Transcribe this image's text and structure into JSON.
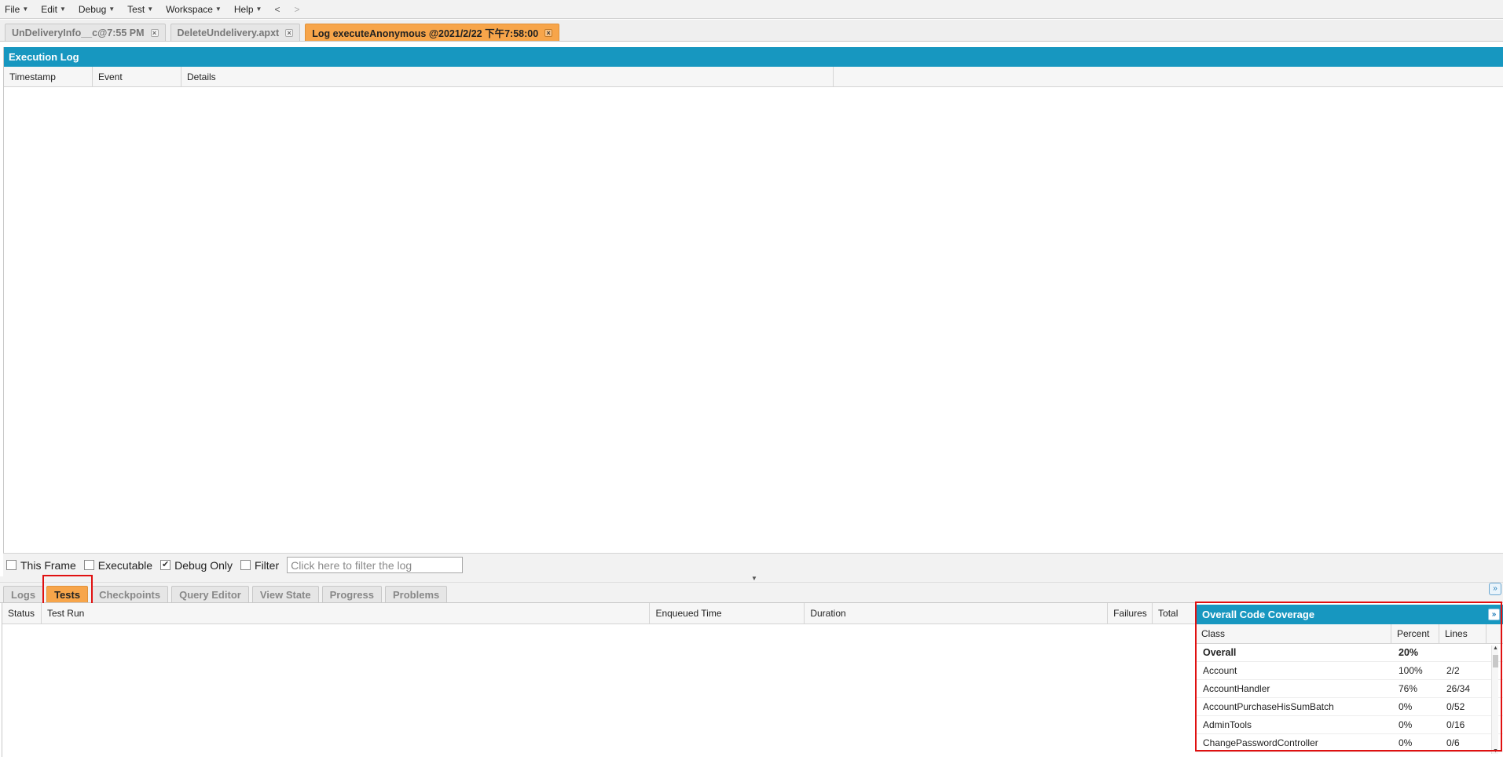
{
  "menu": {
    "items": [
      "File",
      "Edit",
      "Debug",
      "Test",
      "Workspace",
      "Help"
    ],
    "back_arrow": "<",
    "forward_arrow": ">"
  },
  "file_tabs": [
    {
      "label": "UnDeliveryInfo__c@7:55 PM",
      "active": false
    },
    {
      "label": "DeleteUndelivery.apxt",
      "active": false
    },
    {
      "label": "Log executeAnonymous @2021/2/22 下午7:58:00",
      "active": true
    }
  ],
  "execution_log": {
    "title": "Execution Log",
    "columns": [
      "Timestamp",
      "Event",
      "Details"
    ]
  },
  "filter_bar": {
    "this_frame": {
      "label": "This Frame",
      "checked": false
    },
    "executable": {
      "label": "Executable",
      "checked": false
    },
    "debug_only": {
      "label": "Debug Only",
      "checked": true
    },
    "filter": {
      "label": "Filter",
      "checked": false
    },
    "filter_placeholder": "Click here to filter the log"
  },
  "bottom_tabs": [
    {
      "label": "Logs",
      "active": false
    },
    {
      "label": "Tests",
      "active": true
    },
    {
      "label": "Checkpoints",
      "active": false
    },
    {
      "label": "Query Editor",
      "active": false
    },
    {
      "label": "View State",
      "active": false
    },
    {
      "label": "Progress",
      "active": false
    },
    {
      "label": "Problems",
      "active": false
    }
  ],
  "tests_table": {
    "columns": [
      "Status",
      "Test Run",
      "Enqueued Time",
      "Duration",
      "Failures",
      "Total"
    ]
  },
  "coverage": {
    "title": "Overall Code Coverage",
    "columns": [
      "Class",
      "Percent",
      "Lines"
    ],
    "overall": {
      "label": "Overall",
      "percent": "20%",
      "lines": ""
    },
    "rows": [
      {
        "class": "Account",
        "percent": "100%",
        "lines": "2/2"
      },
      {
        "class": "AccountHandler",
        "percent": "76%",
        "lines": "26/34"
      },
      {
        "class": "AccountPurchaseHisSumBatch",
        "percent": "0%",
        "lines": "0/52"
      },
      {
        "class": "AdminTools",
        "percent": "0%",
        "lines": "0/16"
      },
      {
        "class": "ChangePasswordController",
        "percent": "0%",
        "lines": "0/6"
      }
    ]
  },
  "colors": {
    "header_blue": "#1797c0",
    "active_tab_orange": "#f7a54a",
    "highlight_red": "#e01010"
  }
}
